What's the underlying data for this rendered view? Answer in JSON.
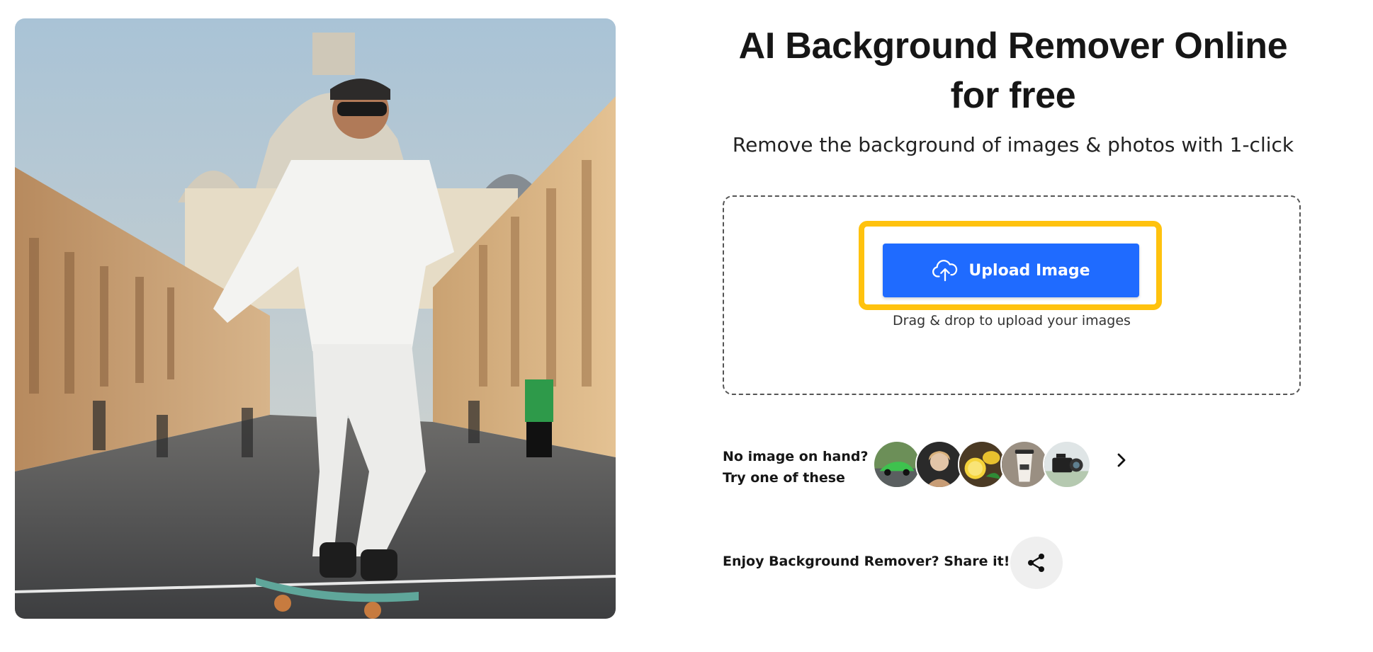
{
  "hero": {
    "image_description_icon": "skateboarder-photo"
  },
  "main": {
    "title_line1": "AI Background Remover Online",
    "title_line2": "for free",
    "subtitle": "Remove the background of images & photos with 1-click"
  },
  "upload": {
    "button_label": "Upload Image",
    "button_icon": "cloud-upload-icon",
    "drag_hint": "Drag & drop to upload your images",
    "highlight_color": "#ffc20e",
    "button_color": "#1f6bff"
  },
  "samples": {
    "label_line1": "No image on hand?",
    "label_line2": "Try one of these",
    "thumbnails": [
      {
        "icon": "green-car-thumbnail"
      },
      {
        "icon": "woman-portrait-thumbnail"
      },
      {
        "icon": "lemons-thumbnail"
      },
      {
        "icon": "coffee-cup-thumbnail"
      },
      {
        "icon": "camera-thumbnail"
      }
    ],
    "next_icon": "chevron-right-icon"
  },
  "share": {
    "label": "Enjoy Background Remover? Share it!",
    "icon": "share-icon"
  }
}
